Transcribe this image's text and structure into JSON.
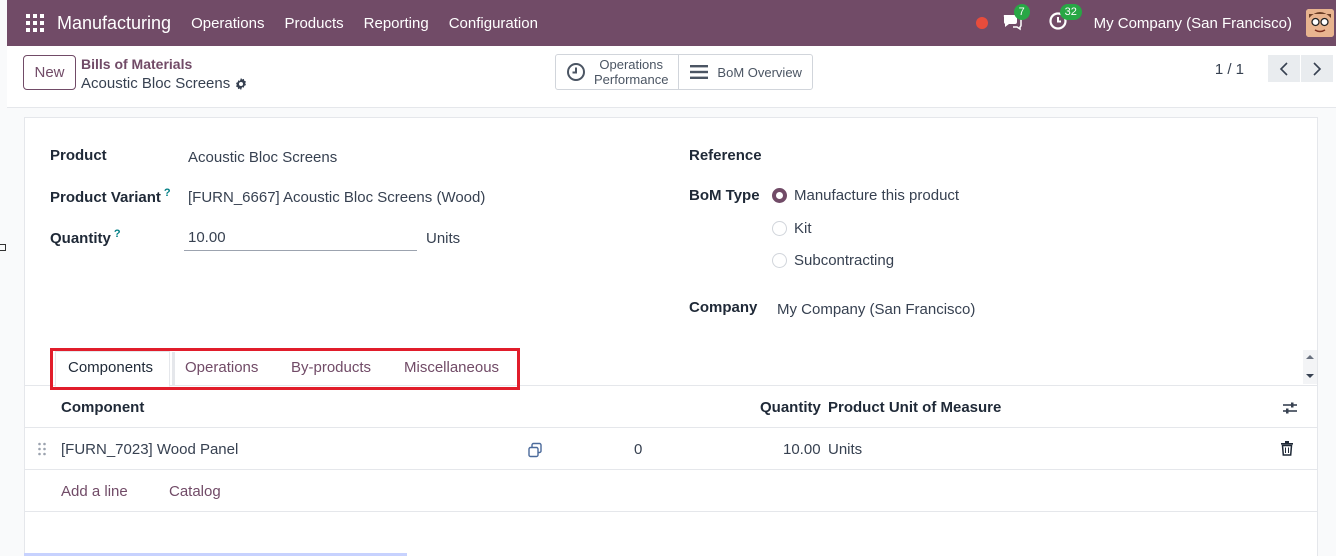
{
  "navbar": {
    "app_name": "Manufacturing",
    "menu": [
      "Operations",
      "Products",
      "Reporting",
      "Configuration"
    ],
    "messages_badge": "7",
    "activities_badge": "32",
    "company": "My Company (San Francisco)"
  },
  "control": {
    "new_label": "New",
    "breadcrumb_parent": "Bills of Materials",
    "breadcrumb_current": "Acoustic Bloc Screens",
    "smart_operations_line1": "Operations",
    "smart_operations_line2": "Performance",
    "smart_bom_overview": "BoM Overview",
    "pager": "1 / 1"
  },
  "form": {
    "product_label": "Product",
    "product_value": "Acoustic Bloc Screens",
    "variant_label": "Product Variant",
    "variant_value": "[FURN_6667] Acoustic Bloc Screens (Wood)",
    "quantity_label": "Quantity",
    "quantity_value": "10.00",
    "quantity_uom": "Units",
    "help_mark": "?",
    "reference_label": "Reference",
    "bom_type_label": "BoM Type",
    "bom_type_options": [
      "Manufacture this product",
      "Kit",
      "Subcontracting"
    ],
    "bom_type_selected": "Manufacture this product",
    "company_label": "Company",
    "company_value": "My Company (San Francisco)"
  },
  "tabs": [
    {
      "label": "Components",
      "active": true
    },
    {
      "label": "Operations",
      "active": false
    },
    {
      "label": "By-products",
      "active": false
    },
    {
      "label": "Miscellaneous",
      "active": false
    }
  ],
  "table": {
    "headers": {
      "component": "Component",
      "quantity": "Quantity",
      "uom": "Product Unit of Measure"
    },
    "rows": [
      {
        "component": "[FURN_7023] Wood Panel",
        "availability": "0",
        "quantity": "10.00",
        "uom": "Units"
      }
    ],
    "add_line": "Add a line",
    "catalog": "Catalog"
  },
  "colors": {
    "brand": "#714b67",
    "highlight": "#e11d2b",
    "badge": "#28a745"
  }
}
